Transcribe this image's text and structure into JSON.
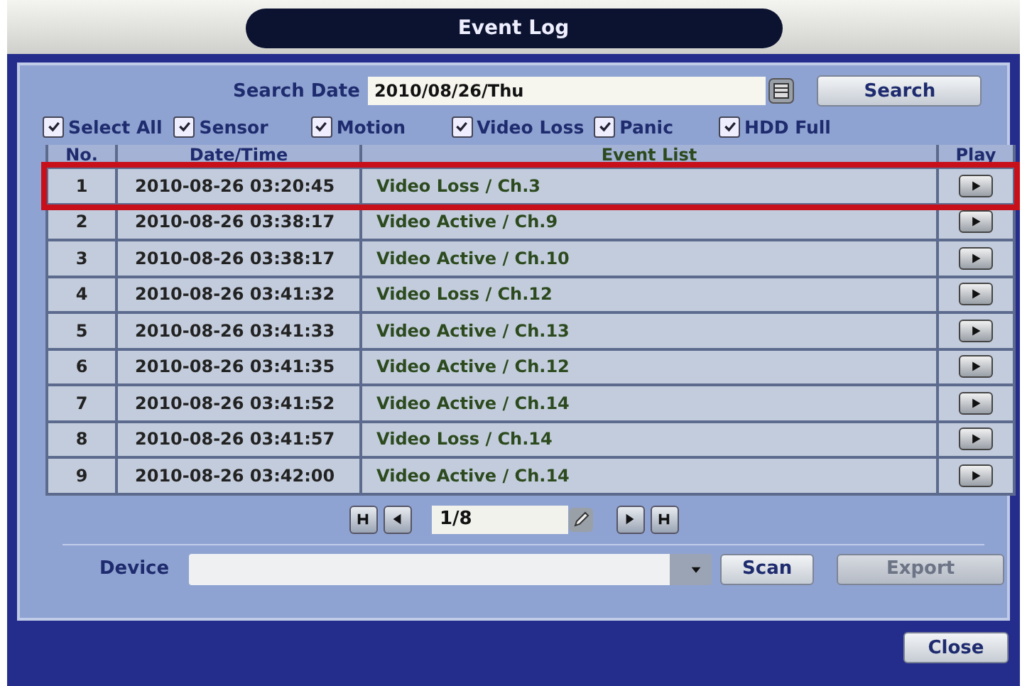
{
  "window": {
    "title": "Event Log"
  },
  "search": {
    "label": "Search Date",
    "value": "2010/08/26/Thu",
    "button": "Search"
  },
  "filters": [
    {
      "label": "Select All",
      "checked": true
    },
    {
      "label": "Sensor",
      "checked": true
    },
    {
      "label": "Motion",
      "checked": true
    },
    {
      "label": "Video Loss",
      "checked": true
    },
    {
      "label": "Panic",
      "checked": true
    },
    {
      "label": "HDD Full",
      "checked": true
    }
  ],
  "table": {
    "columns": [
      "No.",
      "Date/Time",
      "Event List",
      "Play"
    ],
    "rows": [
      {
        "no": "1",
        "datetime": "2010-08-26 03:20:45",
        "event": "Video Loss / Ch.3",
        "highlighted": true
      },
      {
        "no": "2",
        "datetime": "2010-08-26 03:38:17",
        "event": "Video Active / Ch.9",
        "highlighted": false
      },
      {
        "no": "3",
        "datetime": "2010-08-26 03:38:17",
        "event": "Video Active / Ch.10",
        "highlighted": false
      },
      {
        "no": "4",
        "datetime": "2010-08-26 03:41:32",
        "event": "Video Loss / Ch.12",
        "highlighted": false
      },
      {
        "no": "5",
        "datetime": "2010-08-26 03:41:33",
        "event": "Video Active / Ch.13",
        "highlighted": false
      },
      {
        "no": "6",
        "datetime": "2010-08-26 03:41:35",
        "event": "Video Active / Ch.12",
        "highlighted": false
      },
      {
        "no": "7",
        "datetime": "2010-08-26 03:41:52",
        "event": "Video Active / Ch.14",
        "highlighted": false
      },
      {
        "no": "8",
        "datetime": "2010-08-26 03:41:57",
        "event": "Video Loss / Ch.14",
        "highlighted": false
      },
      {
        "no": "9",
        "datetime": "2010-08-26 03:42:00",
        "event": "Video Active / Ch.14",
        "highlighted": false
      }
    ]
  },
  "pager": {
    "page": "1/8"
  },
  "device": {
    "label": "Device",
    "scan": "Scan",
    "export": {
      "label": "Export",
      "disabled": true
    }
  },
  "close": "Close"
}
